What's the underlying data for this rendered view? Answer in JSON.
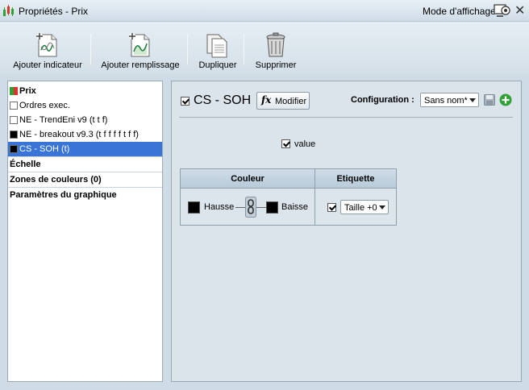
{
  "window": {
    "title": "Propriétés - Prix",
    "mode_label": "Mode d'affichage",
    "icons": [
      "chart-icon",
      "mode-display-icon",
      "close-icon"
    ]
  },
  "toolbar": {
    "add_indicator": "Ajouter indicateur",
    "add_fill": "Ajouter remplissage",
    "duplicate": "Dupliquer",
    "delete": "Supprimer"
  },
  "sidebar": {
    "items": [
      {
        "label": "Prix",
        "swatch": "price-icon",
        "bold": true,
        "selected": false
      },
      {
        "label": "Ordres exec.",
        "swatch": "#ffffff",
        "bold": false,
        "selected": false
      },
      {
        "label": "NE - TrendEni v9 (t t f)",
        "swatch": "#ffffff",
        "bold": false,
        "selected": false
      },
      {
        "label": "NE - breakout v9.3 (t f f f f t f f)",
        "swatch": "#000000",
        "bold": false,
        "selected": false
      },
      {
        "label": "CS - SOH (t)",
        "swatch": "#000000",
        "bold": false,
        "selected": true
      }
    ],
    "sections": [
      "Échelle",
      "Zones de couleurs (0)",
      "Paramètres du graphique"
    ]
  },
  "panel": {
    "indicator_name": "CS - SOH",
    "indicator_checked": true,
    "modify_label": "Modifier",
    "configuration_label": "Configuration :",
    "configuration_value": "Sans nom*",
    "value_checkbox_label": "value",
    "value_checked": true,
    "table": {
      "headers": [
        "Couleur",
        "Etiquette"
      ],
      "up_label": "Hausse",
      "down_label": "Baisse",
      "up_color": "#000000",
      "down_color": "#000000",
      "label_checked": true,
      "size_value": "Taille +0"
    }
  },
  "colors": {
    "selection": "#3875d7",
    "add_config_green": "#2fa033"
  }
}
